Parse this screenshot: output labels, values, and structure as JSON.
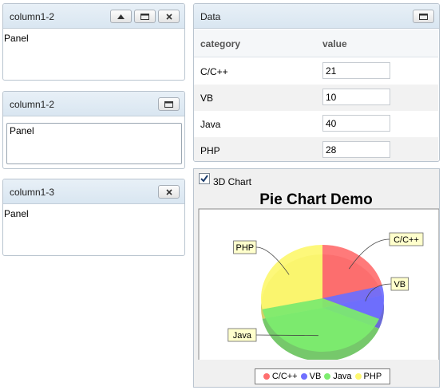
{
  "portlets": {
    "p1": {
      "title": "column1-2",
      "body": "Panel"
    },
    "p2": {
      "title": "column1-2",
      "body": "Panel"
    },
    "p3": {
      "title": "column1-3",
      "body": "Panel"
    }
  },
  "data_panel": {
    "title": "Data",
    "headers": {
      "category": "category",
      "value": "value"
    },
    "rows": [
      {
        "category": "C/C++",
        "value": "21"
      },
      {
        "category": "VB",
        "value": "10"
      },
      {
        "category": "Java",
        "value": "40"
      },
      {
        "category": "PHP",
        "value": "28"
      }
    ]
  },
  "chart_panel": {
    "checkbox_label": "3D Chart",
    "checkbox_checked": true
  },
  "colors": {
    "C/C++": "#ff6f6f",
    "VB": "#6f6fff",
    "Java": "#7ded6f",
    "PHP": "#fdf76f"
  },
  "chart_data": {
    "type": "pie",
    "title": "Pie Chart Demo",
    "categories": [
      "C/C++",
      "VB",
      "Java",
      "PHP"
    ],
    "values": [
      21,
      10,
      40,
      28
    ],
    "three_d": true,
    "legend_position": "bottom"
  }
}
